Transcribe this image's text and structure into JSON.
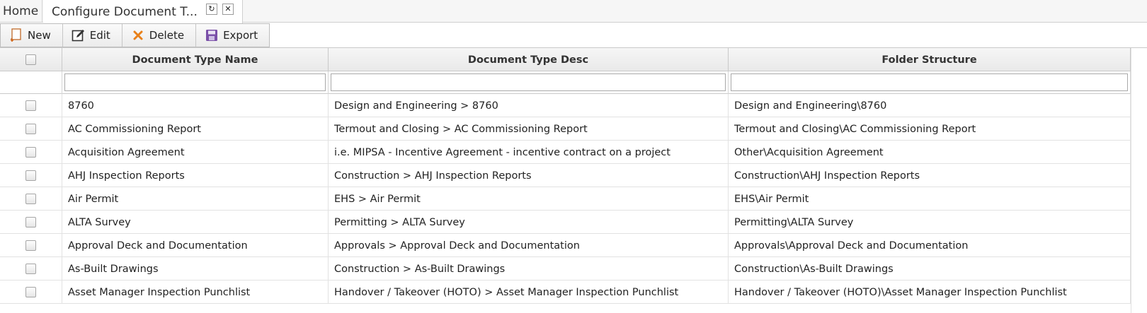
{
  "tabs": {
    "home": "Home",
    "active": "Configure Document T...",
    "refresh_glyph": "↻",
    "close_glyph": "✕"
  },
  "toolbar": {
    "new_label": "New",
    "edit_label": "Edit",
    "delete_label": "Delete",
    "export_label": "Export"
  },
  "colors": {
    "new_icon": "#d2691e",
    "delete_icon": "#e8801a",
    "export_icon": "#7a4fa8"
  },
  "grid": {
    "columns": [
      "Document Type Name",
      "Document Type Desc",
      "Folder Structure"
    ],
    "filters": [
      "",
      "",
      ""
    ],
    "rows": [
      {
        "name": "8760",
        "desc": "Design and Engineering > 8760",
        "folder": "Design and Engineering\\8760"
      },
      {
        "name": "AC Commissioning Report",
        "desc": "Termout and Closing > AC Commissioning Report",
        "folder": "Termout and Closing\\AC Commissioning Report"
      },
      {
        "name": "Acquisition Agreement",
        "desc": "i.e. MIPSA - Incentive Agreement - incentive contract on a project",
        "folder": "Other\\Acquisition Agreement"
      },
      {
        "name": "AHJ Inspection Reports",
        "desc": "Construction > AHJ Inspection Reports",
        "folder": "Construction\\AHJ Inspection Reports"
      },
      {
        "name": "Air Permit",
        "desc": "EHS > Air Permit",
        "folder": "EHS\\Air Permit"
      },
      {
        "name": "ALTA Survey",
        "desc": "Permitting > ALTA Survey",
        "folder": "Permitting\\ALTA Survey"
      },
      {
        "name": "Approval Deck and Documentation",
        "desc": "Approvals > Approval Deck and Documentation",
        "folder": "Approvals\\Approval Deck and Documentation"
      },
      {
        "name": "As-Built Drawings",
        "desc": "Construction > As-Built Drawings",
        "folder": "Construction\\As-Built Drawings"
      },
      {
        "name": "Asset Manager Inspection Punchlist",
        "desc": "Handover / Takeover (HOTO) > Asset Manager Inspection Punchlist",
        "folder": "Handover / Takeover (HOTO)\\Asset Manager Inspection Punchlist"
      }
    ]
  }
}
